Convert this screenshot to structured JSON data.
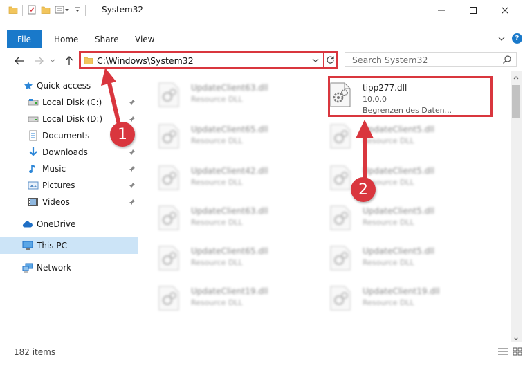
{
  "window": {
    "title": "System32"
  },
  "ribbon": {
    "file": "File",
    "tabs": [
      "Home",
      "Share",
      "View"
    ]
  },
  "address": {
    "path": "C:\\Windows\\System32"
  },
  "search": {
    "placeholder": "Search System32"
  },
  "nav": {
    "items": [
      {
        "label": "Quick access",
        "icon": "star-icon"
      },
      {
        "label": "Local Disk (C:)",
        "icon": "drive-icon"
      },
      {
        "label": "Local Disk (D:)",
        "icon": "drive-icon"
      },
      {
        "label": "Documents",
        "icon": "documents-icon"
      },
      {
        "label": "Downloads",
        "icon": "download-icon"
      },
      {
        "label": "Music",
        "icon": "music-icon"
      },
      {
        "label": "Pictures",
        "icon": "pictures-icon"
      },
      {
        "label": "Videos",
        "icon": "videos-icon"
      },
      {
        "label": "OneDrive",
        "icon": "cloud-icon"
      },
      {
        "label": "This PC",
        "icon": "computer-icon"
      },
      {
        "label": "Network",
        "icon": "network-icon"
      }
    ]
  },
  "files": {
    "highlighted": {
      "name": "tipp277.dll",
      "version": "10.0.0",
      "description": "Begrenzen des Daten..."
    },
    "left_column": [
      {
        "name": "UpdateClient63.dll",
        "type": "Resource DLL"
      },
      {
        "name": "UpdateClient65.dll",
        "type": "Resource DLL"
      },
      {
        "name": "UpdateClient42.dll",
        "type": "Resource DLL"
      },
      {
        "name": "UpdateClient63.dll",
        "type": "Resource DLL"
      },
      {
        "name": "UpdateClient65.dll",
        "type": "Resource DLL"
      },
      {
        "name": "UpdateClient19.dll",
        "type": "Resource DLL"
      }
    ],
    "right_column": [
      {
        "name": "UpdateClient5.dll",
        "type": "Resource DLL"
      },
      {
        "name": "UpdateClient5.dll",
        "type": "Resource DLL"
      },
      {
        "name": "UpdateClient5.dll",
        "type": "Resource DLL"
      },
      {
        "name": "UpdateClient5.dll",
        "type": "Resource DLL"
      },
      {
        "name": "UpdateClient19.dll",
        "type": "Resource DLL"
      }
    ]
  },
  "status": {
    "items": "182 items"
  },
  "annotations": {
    "step1": "1",
    "step2": "2"
  },
  "colors": {
    "accent": "#1979ca",
    "annotation": "#d9363e",
    "selected": "#cce4f7"
  }
}
